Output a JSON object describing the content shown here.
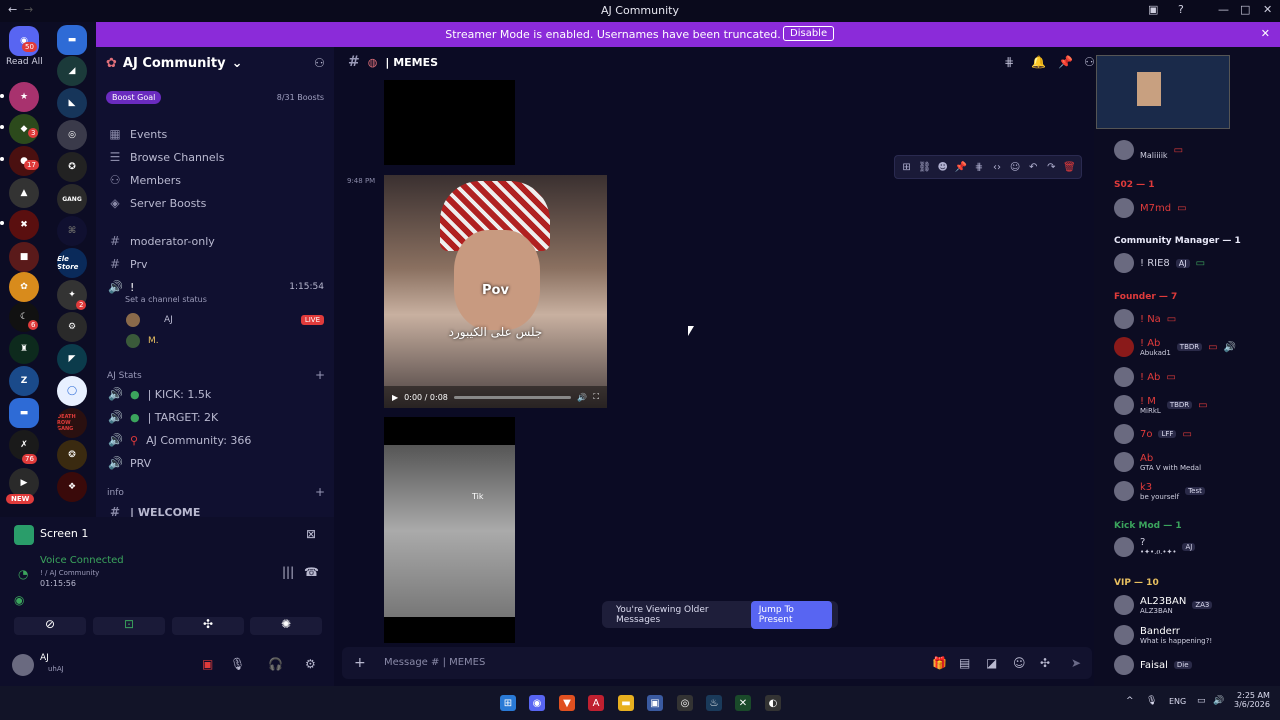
{
  "window": {
    "title": "AJ Community",
    "back_icon": "back-arrow-icon",
    "forward_icon": "forward-arrow-icon"
  },
  "guilds": {
    "read_all": "Read All",
    "home_badge": "50",
    "new_label": "NEW",
    "badges": [
      "3",
      "17",
      "6",
      "2",
      "76"
    ],
    "server_labels": [
      "DEATH ROW GANG",
      "GANG",
      "Ele Store"
    ]
  },
  "banner": {
    "message": "Streamer Mode is enabled. Usernames have been truncated.",
    "disable": "Disable"
  },
  "server": {
    "name": "AJ Community",
    "boost_goal": "Boost Goal",
    "boost_count": "8/31 Boosts",
    "nav": [
      "Events",
      "Browse Channels",
      "Members",
      "Server Boosts"
    ],
    "channels": {
      "moderator": "moderator-only",
      "prv": "Prv",
      "voice_name": "!",
      "voice_time": "1:15:54",
      "status": "Set a channel status",
      "user1": "AJ",
      "live": "LIVE",
      "user2": "M."
    },
    "stats_category": "AJ Stats",
    "stats": [
      "| KICK: 1.5k",
      "| TARGET: 2K",
      "AJ Community: 366",
      "PRV"
    ],
    "info_category": "info",
    "welcome": "| WELCOME"
  },
  "voice": {
    "screen": "Screen 1",
    "connected": "Voice Connected",
    "channel": "! / AJ Community",
    "timer": "01:15:56"
  },
  "user": {
    "name": "AJ",
    "status": "uhAJ"
  },
  "chat": {
    "channel": "| MEMES",
    "timestamp": "9:48 PM",
    "video": {
      "caption": "Pov",
      "arabic": "جلس على الكيبورد",
      "time": "0:00 / 0:08"
    },
    "gif_text": "Tik",
    "older": "You're Viewing Older Messages",
    "jump": "Jump To Present",
    "placeholder": "Message # | MEMES"
  },
  "members": {
    "roles": {
      "s02": "S02 — 1",
      "community": "Community Manager — 1",
      "founder": "Founder — 7",
      "kick": "Kick Mod — 1",
      "vip": "VIP — 10"
    },
    "list": {
      "m0": "Maliiiik",
      "m1": "M7md",
      "m2": "! RIE8",
      "m2tag": "AJ",
      "f1": "! Na",
      "f2": "! Ab",
      "f2sub": "Abukad1",
      "f2tag": "TBDR",
      "f3": "! Ab",
      "f4": "! M",
      "f4sub": "MiRkL",
      "f4tag": "TBDR",
      "f5": "7o",
      "f5tag": "LFF",
      "f6": "Ab",
      "f6sub": "GTA V with Medal",
      "f7": "k3",
      "f7tag": "Test",
      "f7sub": "be yourself",
      "k1": "?",
      "k1tag": "AJ",
      "k1sub": "•✦•.ዐ.•✦•",
      "v1": "AL23BAN",
      "v1tag": "ZA3",
      "v1sub": "ALZ3BAN",
      "v2": "Banderr",
      "v2sub": "What is happening?!",
      "v3": "Faisal",
      "v3tag": "Die"
    }
  },
  "taskbar": {
    "time": "2:25 AM",
    "date": "3/6/2026",
    "lang": "ENG"
  },
  "colors": {
    "accent": "#8b2bd9",
    "blurple": "#5865f2",
    "red": "#e03b3b",
    "bg": "#0b0b24"
  }
}
